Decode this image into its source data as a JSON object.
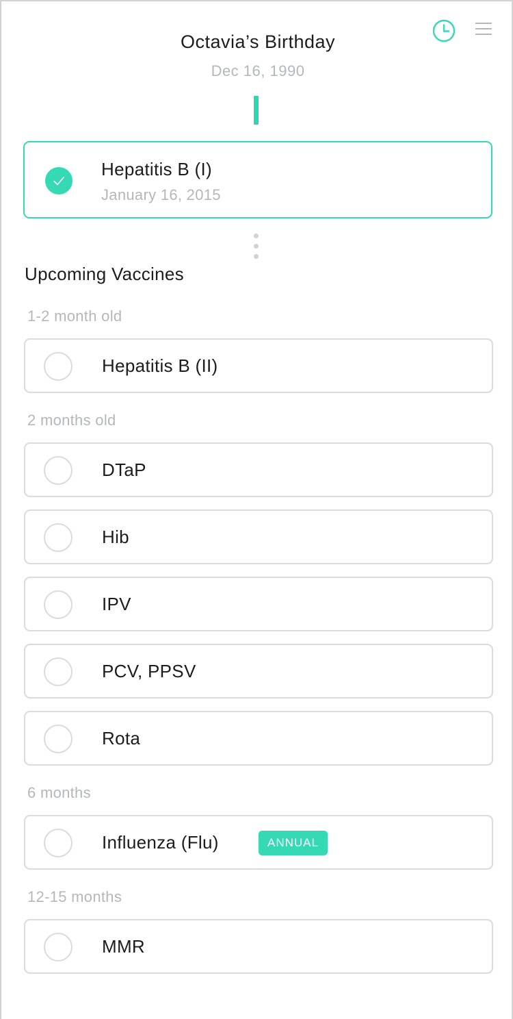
{
  "header": {
    "title": "Octavia’s Birthday",
    "subtitle": "Dec 16, 1990",
    "history_icon": "clock-icon",
    "menu_icon": "hamburger-menu-icon"
  },
  "colors": {
    "accent": "#35d9b3",
    "muted_text": "#b4b8bc",
    "border": "#d8dcdf"
  },
  "completed": [
    {
      "name": "Hepatitis B (I)",
      "date": "January 16, 2015",
      "status_icon": "check-icon"
    }
  ],
  "upcoming": {
    "heading": "Upcoming Vaccines",
    "groups": [
      {
        "label": "1-2 month old",
        "vaccines": [
          {
            "name": "Hepatitis B (II)"
          }
        ]
      },
      {
        "label": "2 months old",
        "vaccines": [
          {
            "name": "DTaP"
          },
          {
            "name": "Hib"
          },
          {
            "name": "IPV"
          },
          {
            "name": "PCV, PPSV"
          },
          {
            "name": "Rota"
          }
        ]
      },
      {
        "label": "6 months",
        "vaccines": [
          {
            "name": "Influenza (Flu)",
            "badge": "ANNUAL"
          }
        ]
      },
      {
        "label": "12-15 months",
        "vaccines": [
          {
            "name": "MMR"
          }
        ]
      }
    ]
  }
}
